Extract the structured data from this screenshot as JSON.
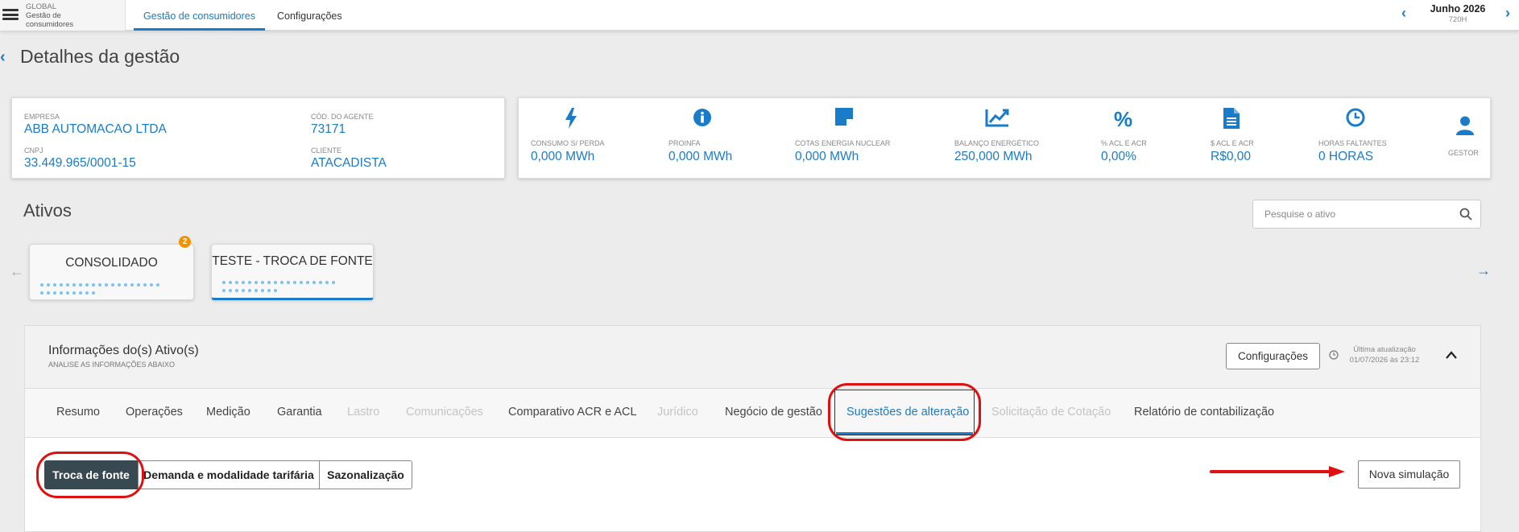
{
  "topbar": {
    "global_label": "GLOBAL",
    "app_label": "Gestão de consumidores",
    "tabs": [
      {
        "label": "Gestão de consumidores"
      },
      {
        "label": "Configurações"
      }
    ],
    "month": "Junho 2026",
    "hours": "720H"
  },
  "page_title": "Detalhes da gestão",
  "company": {
    "empresa_label": "EMPRESA",
    "empresa_value": "ABB AUTOMACAO LTDA",
    "agente_label": "CÓD. DO AGENTE",
    "agente_value": "73171",
    "cnpj_label": "CNPJ",
    "cnpj_value": "33.449.965/0001-15",
    "cliente_label": "CLIENTE",
    "cliente_value": "ATACADISTA"
  },
  "kpis": [
    {
      "icon": "bolt-icon",
      "label": "CONSUMO S/ PERDA",
      "value": "0,000 MWh"
    },
    {
      "icon": "info-icon",
      "label": "PROINFA",
      "value": "0,000 MWh"
    },
    {
      "icon": "note-icon",
      "label": "COTAS ENERGIA NUCLEAR",
      "value": "0,000 MWh"
    },
    {
      "icon": "chart-line-icon",
      "label": "BALANÇO ENERGÉTICO",
      "value": "250,000 MWh"
    },
    {
      "icon": "percent-icon",
      "label": "% ACL E ACR",
      "value": "0,00%"
    },
    {
      "icon": "document-icon",
      "label": "$ ACL E ACR",
      "value": "R$0,00"
    },
    {
      "icon": "clock-icon",
      "label": "HORAS FALTANTES",
      "value": "0 HORAS"
    },
    {
      "icon": "user-icon",
      "label": "GESTOR",
      "value": ""
    }
  ],
  "ativos": {
    "title": "Ativos",
    "search_placeholder": "Pesquise o ativo",
    "cards": [
      {
        "title": "CONSOLIDADO",
        "badge": "2"
      },
      {
        "title": "TESTE - TROCA DE FONTE"
      }
    ]
  },
  "info_panel": {
    "title": "Informações do(s) Ativo(s)",
    "subtitle": "ANALISE AS INFORMAÇÕES ABAIXO",
    "config_button": "Configurações",
    "last_update_label": "Última atualização",
    "last_update_value": "01/07/2026 às 23:12",
    "tabs": [
      {
        "label": "Resumo",
        "state": "normal"
      },
      {
        "label": "Operações",
        "state": "normal"
      },
      {
        "label": "Medição",
        "state": "normal"
      },
      {
        "label": "Garantia",
        "state": "normal"
      },
      {
        "label": "Lastro",
        "state": "disabled"
      },
      {
        "label": "Comunicações",
        "state": "disabled"
      },
      {
        "label": "Comparativo ACR e ACL",
        "state": "normal"
      },
      {
        "label": "Jurídico",
        "state": "disabled"
      },
      {
        "label": "Negócio de gestão",
        "state": "normal"
      },
      {
        "label": "Sugestões de alteração",
        "state": "active"
      },
      {
        "label": "Solicitação de Cotação",
        "state": "disabled"
      },
      {
        "label": "Relatório de contabilização",
        "state": "normal"
      }
    ],
    "segments": [
      {
        "label": "Troca de fonte",
        "active": true
      },
      {
        "label": "Demanda e modalidade tarifária",
        "active": false
      },
      {
        "label": "Sazonalização",
        "active": false
      }
    ],
    "new_button": "Nova simulação"
  },
  "colors": {
    "accent": "#1a7bc8",
    "segment_active": "#394952",
    "annotation_red": "#e01010",
    "badge": "#f39200"
  }
}
